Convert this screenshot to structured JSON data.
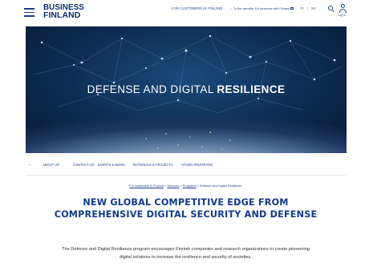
{
  "header": {
    "logo_line1": "BUSINESS",
    "logo_line2": "FINLAND",
    "customers_link": "FOR CUSTOMERS IN FINLAND",
    "external_link": "→ To the website: Do business with Finland",
    "lang_fi": "FI",
    "lang_sep": "|",
    "lang_sv": "SV",
    "login_label": "Log in",
    "icons": {
      "menu": "hamburger-menu-icon",
      "search": "search-icon",
      "user": "user-icon",
      "external": "external-link-icon"
    }
  },
  "hero": {
    "title_regular": "DEFENSE AND DIGITAL ",
    "title_strong": "RESILIENCE"
  },
  "subnav": {
    "back": "←",
    "items": [
      "ABOUT US",
      "CONTACT US",
      "EVENTS & NEWS",
      "MATERIALS & PROJECTS",
      "OTHER PROGRAMS"
    ]
  },
  "breadcrumb": {
    "items": [
      "For customers in Finland",
      "Services",
      "Programs",
      "Defense and Digital Resilience"
    ],
    "separator": " » "
  },
  "main": {
    "title": "NEW GLOBAL COMPETITIVE EDGE FROM COMPREHENSIVE DIGITAL SECURITY AND DEFENSE",
    "intro": "The Defense and Digital Resilience program encourages Finnish companies and research organizations to create pioneering digital  solutions to increase the resilience and security of societies."
  },
  "colors": {
    "brand_blue": "#123a8c",
    "link_blue": "#1e3f8f",
    "hero_dark": "#0e2c54"
  }
}
